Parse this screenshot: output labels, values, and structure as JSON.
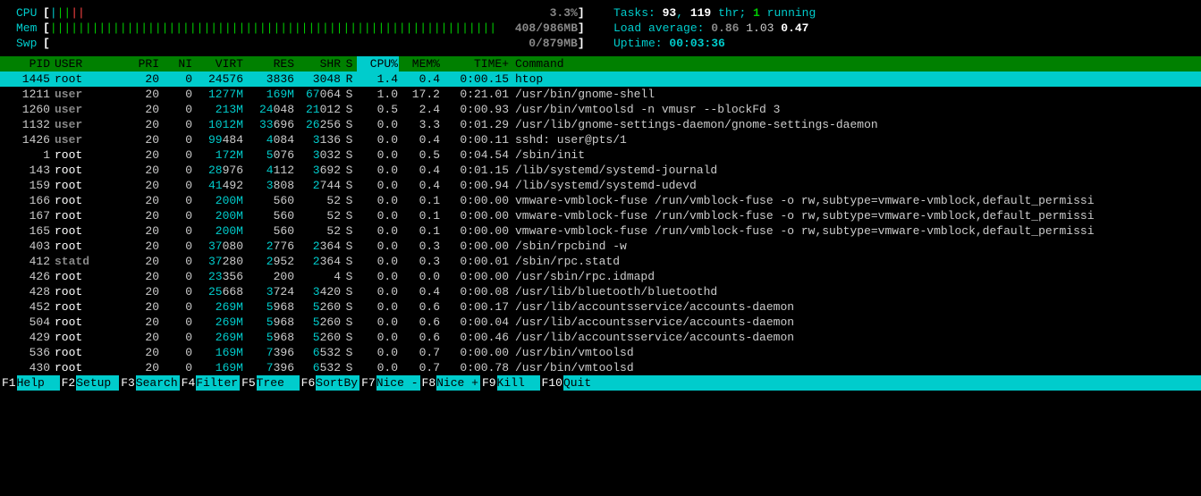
{
  "meters": {
    "cpu": {
      "label": "CPU",
      "bar_low": "|",
      "bar_green": "||",
      "bar_red": "||",
      "text": "3.3%"
    },
    "mem": {
      "label": "Mem",
      "bar": "||||||||||||||||||||||||||||||||||||||||||||||||||||||||||||||||",
      "text": "408/986MB"
    },
    "swp": {
      "label": "Swp",
      "bar": "",
      "text": "0/879MB"
    }
  },
  "info": {
    "tasks_label": "Tasks: ",
    "tasks_procs": "93",
    "tasks_sep": ", ",
    "tasks_threads": "119",
    "tasks_thr": " thr; ",
    "tasks_running": "1",
    "tasks_running_label": " running",
    "load_label": "Load average: ",
    "load1": "0.86",
    "load2": "1.03",
    "load3": "0.47",
    "uptime_label": "Uptime: ",
    "uptime_value": "00:03:36"
  },
  "columns": [
    "PID",
    "USER",
    "PRI",
    "NI",
    "VIRT",
    "RES",
    "SHR",
    "S",
    "CPU%",
    "MEM%",
    "TIME+",
    "Command"
  ],
  "sorted_col": "CPU%",
  "processes": [
    {
      "pid": "1445",
      "user": "root",
      "utype": "root",
      "pri": "20",
      "ni": "0",
      "virt": "24576",
      "virt_hi": "",
      "res": "3836",
      "res_hi": "",
      "shr": "3048",
      "shr_hi": "",
      "s": "R",
      "cpu": "1.4",
      "mem": "0.4",
      "time": "0:00.15",
      "cmd": "htop",
      "hl": true
    },
    {
      "pid": "1211",
      "user": "user",
      "utype": "other",
      "pri": "20",
      "ni": "0",
      "virt": "",
      "virt_hi": "1277M",
      "res": "",
      "res_hi": "169M",
      "shr": "064",
      "shr_hi": "67",
      "s": "S",
      "cpu": "1.0",
      "mem": "17.2",
      "time": "0:21.01",
      "cmd": "/usr/bin/gnome-shell"
    },
    {
      "pid": "1260",
      "user": "user",
      "utype": "other",
      "pri": "20",
      "ni": "0",
      "virt": "",
      "virt_hi": "213M",
      "res": "048",
      "res_hi": "24",
      "shr": "012",
      "shr_hi": "21",
      "s": "S",
      "cpu": "0.5",
      "mem": "2.4",
      "time": "0:00.93",
      "cmd": "/usr/bin/vmtoolsd -n vmusr --blockFd 3"
    },
    {
      "pid": "1132",
      "user": "user",
      "utype": "other",
      "pri": "20",
      "ni": "0",
      "virt": "",
      "virt_hi": "1012M",
      "res": "696",
      "res_hi": "33",
      "shr": "256",
      "shr_hi": "26",
      "s": "S",
      "cpu": "0.0",
      "mem": "3.3",
      "time": "0:01.29",
      "cmd": "/usr/lib/gnome-settings-daemon/gnome-settings-daemon"
    },
    {
      "pid": "1426",
      "user": "user",
      "utype": "other",
      "pri": "20",
      "ni": "0",
      "virt": "484",
      "virt_hi": "99",
      "res": "084",
      "res_hi": "4",
      "shr": "136",
      "shr_hi": "3",
      "s": "S",
      "cpu": "0.0",
      "mem": "0.4",
      "time": "0:00.11",
      "cmd": "sshd: user@pts/1"
    },
    {
      "pid": "1",
      "user": "root",
      "utype": "root",
      "pri": "20",
      "ni": "0",
      "virt": "",
      "virt_hi": "172M",
      "res": "076",
      "res_hi": "5",
      "shr": "032",
      "shr_hi": "3",
      "s": "S",
      "cpu": "0.0",
      "mem": "0.5",
      "time": "0:04.54",
      "cmd": "/sbin/init"
    },
    {
      "pid": "143",
      "user": "root",
      "utype": "root",
      "pri": "20",
      "ni": "0",
      "virt": "976",
      "virt_hi": "28",
      "res": "112",
      "res_hi": "4",
      "shr": "692",
      "shr_hi": "3",
      "s": "S",
      "cpu": "0.0",
      "mem": "0.4",
      "time": "0:01.15",
      "cmd": "/lib/systemd/systemd-journald"
    },
    {
      "pid": "159",
      "user": "root",
      "utype": "root",
      "pri": "20",
      "ni": "0",
      "virt": "492",
      "virt_hi": "41",
      "res": "808",
      "res_hi": "3",
      "shr": "744",
      "shr_hi": "2",
      "s": "S",
      "cpu": "0.0",
      "mem": "0.4",
      "time": "0:00.94",
      "cmd": "/lib/systemd/systemd-udevd"
    },
    {
      "pid": "166",
      "user": "root",
      "utype": "root",
      "pri": "20",
      "ni": "0",
      "virt": "",
      "virt_hi": "200M",
      "res": "560",
      "res_hi": "",
      "shr": "52",
      "shr_hi": "",
      "s": "S",
      "cpu": "0.0",
      "mem": "0.1",
      "time": "0:00.00",
      "cmd": "vmware-vmblock-fuse /run/vmblock-fuse -o rw,subtype=vmware-vmblock,default_permissi"
    },
    {
      "pid": "167",
      "user": "root",
      "utype": "root",
      "pri": "20",
      "ni": "0",
      "virt": "",
      "virt_hi": "200M",
      "res": "560",
      "res_hi": "",
      "shr": "52",
      "shr_hi": "",
      "s": "S",
      "cpu": "0.0",
      "mem": "0.1",
      "time": "0:00.00",
      "cmd": "vmware-vmblock-fuse /run/vmblock-fuse -o rw,subtype=vmware-vmblock,default_permissi"
    },
    {
      "pid": "165",
      "user": "root",
      "utype": "root",
      "pri": "20",
      "ni": "0",
      "virt": "",
      "virt_hi": "200M",
      "res": "560",
      "res_hi": "",
      "shr": "52",
      "shr_hi": "",
      "s": "S",
      "cpu": "0.0",
      "mem": "0.1",
      "time": "0:00.00",
      "cmd": "vmware-vmblock-fuse /run/vmblock-fuse -o rw,subtype=vmware-vmblock,default_permissi"
    },
    {
      "pid": "403",
      "user": "root",
      "utype": "root",
      "pri": "20",
      "ni": "0",
      "virt": "080",
      "virt_hi": "37",
      "res": "776",
      "res_hi": "2",
      "shr": "364",
      "shr_hi": "2",
      "s": "S",
      "cpu": "0.0",
      "mem": "0.3",
      "time": "0:00.00",
      "cmd": "/sbin/rpcbind -w"
    },
    {
      "pid": "412",
      "user": "statd",
      "utype": "other",
      "pri": "20",
      "ni": "0",
      "virt": "280",
      "virt_hi": "37",
      "res": "952",
      "res_hi": "2",
      "shr": "364",
      "shr_hi": "2",
      "s": "S",
      "cpu": "0.0",
      "mem": "0.3",
      "time": "0:00.01",
      "cmd": "/sbin/rpc.statd"
    },
    {
      "pid": "426",
      "user": "root",
      "utype": "root",
      "pri": "20",
      "ni": "0",
      "virt": "356",
      "virt_hi": "23",
      "res": "200",
      "res_hi": "",
      "shr": "4",
      "shr_hi": "",
      "s": "S",
      "cpu": "0.0",
      "mem": "0.0",
      "time": "0:00.00",
      "cmd": "/usr/sbin/rpc.idmapd"
    },
    {
      "pid": "428",
      "user": "root",
      "utype": "root",
      "pri": "20",
      "ni": "0",
      "virt": "668",
      "virt_hi": "25",
      "res": "724",
      "res_hi": "3",
      "shr": "420",
      "shr_hi": "3",
      "s": "S",
      "cpu": "0.0",
      "mem": "0.4",
      "time": "0:00.08",
      "cmd": "/usr/lib/bluetooth/bluetoothd"
    },
    {
      "pid": "452",
      "user": "root",
      "utype": "root",
      "pri": "20",
      "ni": "0",
      "virt": "",
      "virt_hi": "269M",
      "res": "968",
      "res_hi": "5",
      "shr": "260",
      "shr_hi": "5",
      "s": "S",
      "cpu": "0.0",
      "mem": "0.6",
      "time": "0:00.17",
      "cmd": "/usr/lib/accountsservice/accounts-daemon"
    },
    {
      "pid": "504",
      "user": "root",
      "utype": "root",
      "pri": "20",
      "ni": "0",
      "virt": "",
      "virt_hi": "269M",
      "res": "968",
      "res_hi": "5",
      "shr": "260",
      "shr_hi": "5",
      "s": "S",
      "cpu": "0.0",
      "mem": "0.6",
      "time": "0:00.04",
      "cmd": "/usr/lib/accountsservice/accounts-daemon"
    },
    {
      "pid": "429",
      "user": "root",
      "utype": "root",
      "pri": "20",
      "ni": "0",
      "virt": "",
      "virt_hi": "269M",
      "res": "968",
      "res_hi": "5",
      "shr": "260",
      "shr_hi": "5",
      "s": "S",
      "cpu": "0.0",
      "mem": "0.6",
      "time": "0:00.46",
      "cmd": "/usr/lib/accountsservice/accounts-daemon"
    },
    {
      "pid": "536",
      "user": "root",
      "utype": "root",
      "pri": "20",
      "ni": "0",
      "virt": "",
      "virt_hi": "169M",
      "res": "396",
      "res_hi": "7",
      "shr": "532",
      "shr_hi": "6",
      "s": "S",
      "cpu": "0.0",
      "mem": "0.7",
      "time": "0:00.00",
      "cmd": "/usr/bin/vmtoolsd"
    },
    {
      "pid": "430",
      "user": "root",
      "utype": "root",
      "pri": "20",
      "ni": "0",
      "virt": "",
      "virt_hi": "169M",
      "res": "396",
      "res_hi": "7",
      "shr": "532",
      "shr_hi": "6",
      "s": "S",
      "cpu": "0.0",
      "mem": "0.7",
      "time": "0:00.78",
      "cmd": "/usr/bin/vmtoolsd"
    }
  ],
  "footer": [
    {
      "key": "F1",
      "label": "Help  "
    },
    {
      "key": "F2",
      "label": "Setup "
    },
    {
      "key": "F3",
      "label": "Search"
    },
    {
      "key": "F4",
      "label": "Filter"
    },
    {
      "key": "F5",
      "label": "Tree  "
    },
    {
      "key": "F6",
      "label": "SortBy"
    },
    {
      "key": "F7",
      "label": "Nice -"
    },
    {
      "key": "F8",
      "label": "Nice +"
    },
    {
      "key": "F9",
      "label": "Kill  "
    },
    {
      "key": "F10",
      "label": "Quit  "
    }
  ]
}
